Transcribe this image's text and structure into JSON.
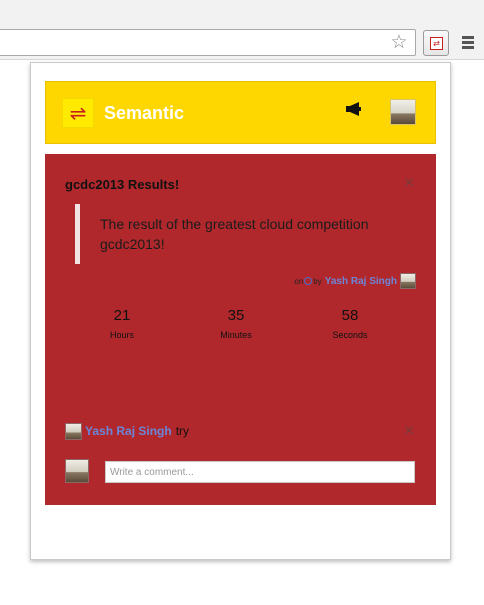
{
  "browser": {
    "star_icon": "star-icon",
    "extension_icon": "semantic-extension-icon",
    "menu_icon": "hamburger-menu-icon"
  },
  "header": {
    "brand": "Semantic",
    "logo_glyph": "⇌",
    "icons": [
      "megaphone-icon",
      "user-avatar"
    ]
  },
  "post": {
    "title": "gcdc2013 Results!",
    "body": "The result of the greatest cloud competition gcdc2013!",
    "meta": {
      "on": "on",
      "by": "by",
      "author": "Yash Raj Singh"
    }
  },
  "countdown": [
    {
      "value": "21",
      "unit": "Hours"
    },
    {
      "value": "35",
      "unit": "Minutes"
    },
    {
      "value": "58",
      "unit": "Seconds"
    }
  ],
  "comment": {
    "author": "Yash Raj Singh",
    "text": "try"
  },
  "composer": {
    "placeholder": "Write a comment..."
  },
  "colors": {
    "header_bg": "#ffd700",
    "card_bg": "#b0282c",
    "author_link": "#6b86d8",
    "logo_red": "#c81e1e"
  }
}
